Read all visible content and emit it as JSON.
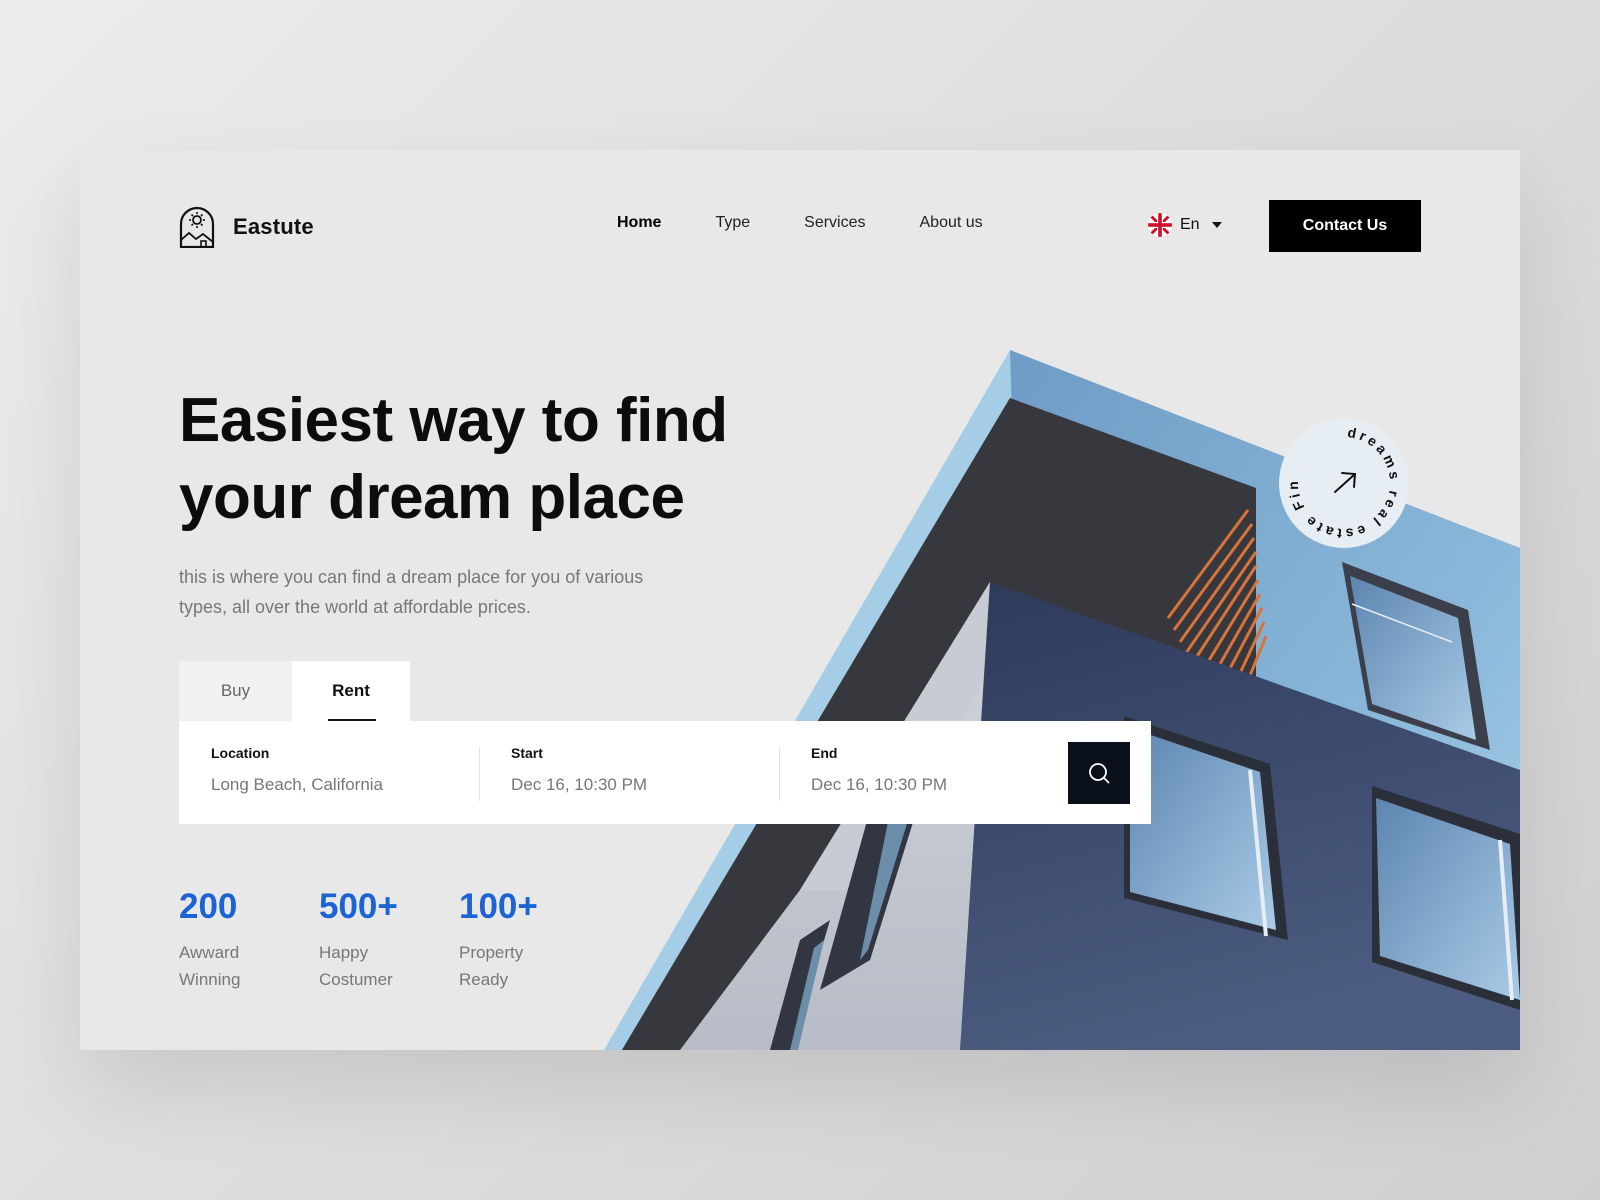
{
  "brand": {
    "name": "Eastute",
    "logo_icon": "sun-arch-house-icon"
  },
  "nav": {
    "items": [
      {
        "label": "Home",
        "active": true
      },
      {
        "label": "Type",
        "active": false
      },
      {
        "label": "Services",
        "active": false
      },
      {
        "label": "About us",
        "active": false
      }
    ]
  },
  "language": {
    "label": "En",
    "flag_icon": "uk-flag-icon"
  },
  "header": {
    "contact_label": "Contact Us"
  },
  "hero": {
    "title_line1": "Easiest way to find",
    "title_line2": "your dream place",
    "subtitle": "this is where you can find a dream place for you of various types, all over the world at affordable prices."
  },
  "tabs": {
    "buy": "Buy",
    "rent": "Rent",
    "selected": "Rent"
  },
  "search": {
    "location": {
      "label": "Location",
      "value": "Long Beach, California"
    },
    "start": {
      "label": "Start",
      "value": "Dec 16, 10:30 PM"
    },
    "end": {
      "label": "End",
      "value": "Dec 16, 10:30 PM"
    },
    "button_icon": "search-icon"
  },
  "stats": [
    {
      "value": "200",
      "label": "Awward Winning"
    },
    {
      "value": "500+",
      "label": "Happy Costumer"
    },
    {
      "value": "100+",
      "label": "Property Ready"
    }
  ],
  "badge": {
    "text": "dreams real estate Find your ",
    "icon": "arrow-up-right-icon"
  },
  "colors": {
    "accent": "#1c63d5",
    "dark": "#000000",
    "search_button": "#0a0f1c",
    "background": "#e8e8e8"
  }
}
